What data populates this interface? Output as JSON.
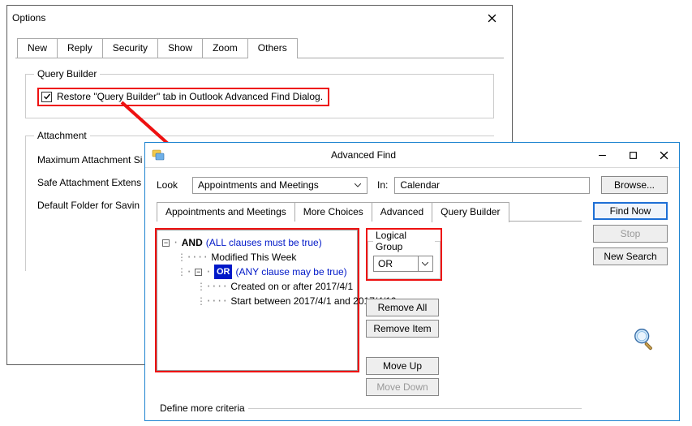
{
  "options": {
    "title": "Options",
    "tabs": [
      "New",
      "Reply",
      "Security",
      "Show",
      "Zoom",
      "Others"
    ],
    "active_tab_index": 5,
    "query_builder_group": {
      "legend": "Query Builder",
      "checkbox_checked": true,
      "checkbox_label": "Restore \"Query Builder\" tab in Outlook Advanced Find Dialog."
    },
    "attachment_group": {
      "legend": "Attachment",
      "rows": [
        "Maximum Attachment Si",
        "Safe Attachment Extens",
        "Default Folder for Savin"
      ]
    }
  },
  "advanced_find": {
    "title": "Advanced Find",
    "look_label": "Look",
    "look_value": "Appointments and Meetings",
    "in_label": "In:",
    "in_value": "Calendar",
    "browse_label": "Browse...",
    "tabs": [
      "Appointments and Meetings",
      "More Choices",
      "Advanced",
      "Query Builder"
    ],
    "active_tab_index": 3,
    "buttons": {
      "find_now": "Find Now",
      "stop": "Stop",
      "new_search": "New Search",
      "remove_all": "Remove All",
      "remove_item": "Remove Item",
      "move_up": "Move Up",
      "move_down": "Move Down"
    },
    "logical_group": {
      "legend": "Logical Group",
      "value": "OR"
    },
    "tree": {
      "and_label": "AND",
      "and_note": "(ALL clauses must be true)",
      "modified": "Modified This Week",
      "or_label": "OR",
      "or_note": "(ANY clause may be true)",
      "created": "Created on or after 2017/4/1",
      "start": "Start between 2017/4/1 and 2017/4/10"
    },
    "define_legend": "Define more criteria"
  }
}
